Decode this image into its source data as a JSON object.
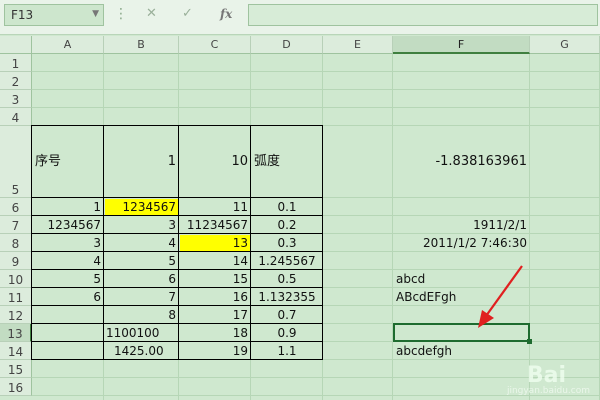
{
  "name_box": {
    "value": "F13"
  },
  "formula_bar": {
    "value": "",
    "cancel_glyph": "✕",
    "enter_glyph": "✓",
    "fx_label": "fx",
    "more_glyph": "⋮"
  },
  "columns": [
    "A",
    "B",
    "C",
    "D",
    "E",
    "F",
    "G"
  ],
  "rows": [
    "1",
    "2",
    "3",
    "4",
    "5",
    "6",
    "7",
    "8",
    "9",
    "10",
    "11",
    "12",
    "13",
    "14",
    "15",
    "16"
  ],
  "selected_column": "F",
  "selected_row": "13",
  "cells": {
    "A5": "序号",
    "B5": "1",
    "C5": "10",
    "D5": "弧度",
    "F5": "-1.838163961",
    "A6": "1",
    "B6": "1234567",
    "C6": "11",
    "D6": "0.1",
    "A7": "1234567",
    "B7": "3",
    "C7": "11234567",
    "D7": "0.2",
    "F7": "1911/2/1",
    "A8": "3",
    "B8": "4",
    "C8": "13",
    "D8": "0.3",
    "F8": "2011/1/2 7:46:30",
    "A9": "4",
    "B9": "5",
    "C9": "14",
    "D9": "1.245567",
    "A10": "5",
    "B10": "6",
    "C10": "15",
    "D10": "0.5",
    "F10": "abcd",
    "A11": "6",
    "B11": "7",
    "C11": "16",
    "D11": "1.132355",
    "F11": "ABcdEFgh",
    "B12": "8",
    "C12": "17",
    "D12": "0.7",
    "B13": "1100100",
    "C13": "18",
    "D13": "0.9",
    "B14": "1425.00",
    "C14": "19",
    "D14": "1.1",
    "F14": "abcdefgh"
  },
  "highlight_color": "#ffff00",
  "watermark": {
    "text": "jingyan.baidu.com",
    "logo": "Bai"
  }
}
